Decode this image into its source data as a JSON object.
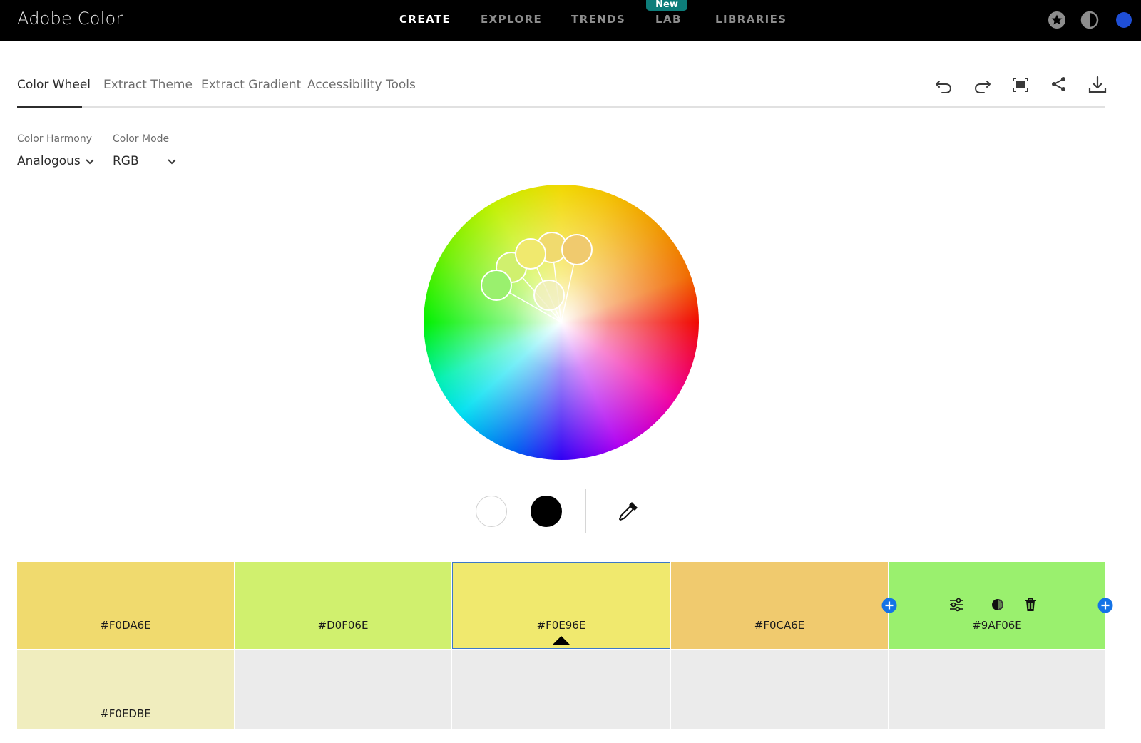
{
  "header": {
    "brand": "Adobe Color",
    "nav": [
      "CREATE",
      "EXPLORE",
      "TRENDS",
      "LAB",
      "LIBRARIES"
    ],
    "active_nav": "CREATE",
    "badge": "New",
    "icons": [
      "star-icon",
      "contrast-icon"
    ]
  },
  "tabs": {
    "items": [
      "Color Wheel",
      "Extract Theme",
      "Extract Gradient",
      "Accessibility Tools"
    ],
    "active": "Color Wheel"
  },
  "toolbar": {
    "icons": [
      "undo-icon",
      "redo-icon",
      "fullscreen-icon",
      "share-icon",
      "download-icon"
    ]
  },
  "controls": {
    "harmony_label": "Color Harmony",
    "harmony_value": "Analogous",
    "mode_label": "Color Mode",
    "mode_value": "RGB"
  },
  "wheel_handles": [
    {
      "hex": "#F0DA6E"
    },
    {
      "hex": "#D0F06E"
    },
    {
      "hex": "#F0E96E"
    },
    {
      "hex": "#F0CA6E"
    },
    {
      "hex": "#9AF06E"
    }
  ],
  "palette": [
    {
      "hex": "#F0DA6E",
      "color": "#F0DA6E"
    },
    {
      "hex": "#D0F06E",
      "color": "#D0F06E"
    },
    {
      "hex": "#F0E96E",
      "color": "#F0E96E",
      "selected": true
    },
    {
      "hex": "#F0CA6E",
      "color": "#F0CA6E"
    },
    {
      "hex": "#9AF06E",
      "color": "#9AF06E"
    }
  ],
  "shades": [
    {
      "hex": "#F0EDBE",
      "color": "#F0EDBE"
    }
  ],
  "colors": {
    "accent_blue": "#1473E6",
    "empty_card": "#EBEBEB"
  }
}
